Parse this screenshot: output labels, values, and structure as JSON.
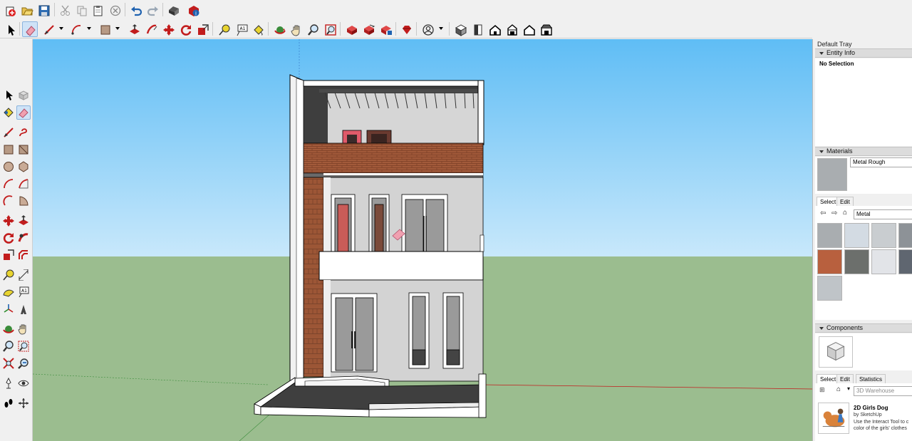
{
  "toolbars": {
    "top": [
      "new-icon",
      "open-icon",
      "save-icon",
      "cut-icon",
      "copy-icon",
      "paste-icon",
      "erase-icon",
      "undo-icon",
      "redo-icon",
      "print-icon",
      "model-info-icon"
    ],
    "second": [
      "select-icon",
      "eraser-icon",
      "line-icon",
      "arc-icon",
      "rectangle-icon",
      "push-pull-icon",
      "follow-me-icon",
      "move-icon",
      "rotate-icon",
      "scale-icon",
      "tape-measure-icon",
      "text-icon",
      "paint-bucket-icon",
      "orbit-icon",
      "pan-icon",
      "zoom-icon",
      "zoom-extents-icon",
      "3d-warehouse-icon",
      "share-model-icon",
      "extension-warehouse-icon",
      "ruby-icon",
      "account-icon",
      "iso-view-icon",
      "top-view-icon",
      "front-view-icon",
      "right-view-icon",
      "back-view-icon",
      "left-view-icon"
    ]
  },
  "tray": {
    "title": "Default Tray",
    "entity_info": {
      "title": "Entity Info",
      "selection": "No Selection"
    },
    "materials": {
      "title": "Materials",
      "current_material": "Metal Rough",
      "tabs": [
        "Select",
        "Edit"
      ],
      "collection": "Metal",
      "swatches": [
        "#a9adb0",
        "#d3dbe3",
        "#c9cdd0",
        "#8d9297",
        "#b8603e",
        "#6c6f6c",
        "#e2e4e8",
        "#5f6670",
        "#bfc4c8"
      ]
    },
    "components": {
      "title": "Components",
      "tabs": [
        "Select",
        "Edit",
        "Statistics"
      ],
      "search_placeholder": "3D Warehouse",
      "item": {
        "name": "2D Girls Dog",
        "author": "by SketchUp",
        "description": "Use the Interact Tool to c color of the girls' clothes a"
      }
    }
  },
  "colors": {
    "sky_top": "#5fbdf5",
    "sky_bottom": "#c8e8fb",
    "ground": "#9bbd8f",
    "brick": "#a25a3a",
    "wall": "#d5d5d5",
    "accent_selected": "#cfe3f7"
  }
}
